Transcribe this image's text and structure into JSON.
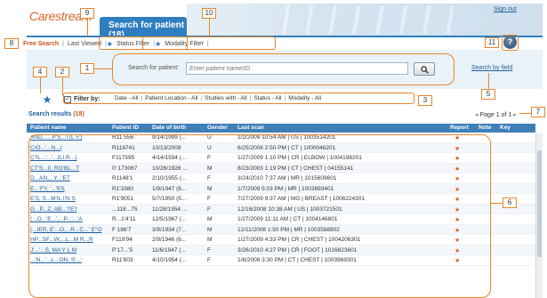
{
  "header": {
    "logo": "Carestream",
    "page_title": "Search for patient (18)",
    "signout": "Sign out"
  },
  "tabs": {
    "free_search": "Free Search",
    "last_viewed": "Last Viewed",
    "status_filter": "Status Filter",
    "modality_filter": "Modality Filter"
  },
  "help": {
    "label": "?"
  },
  "search": {
    "label": "Search for patient:",
    "placeholder": "Enter patient name/ID",
    "by_field": "Search by field"
  },
  "filter": {
    "label": "Filter by:",
    "items": [
      "Date - All",
      "Patient Location - All",
      "Studies with - All",
      "Status - All",
      "Modality - All"
    ]
  },
  "results": {
    "title": "Search results",
    "count": "(18)",
    "page_label": "Page 1 of 1",
    "columns": [
      "Patient name",
      "Patient ID",
      "Date of birth",
      "Gender",
      "Last scan",
      "Report",
      "Note",
      "Key"
    ],
    "rows": [
      [
        "AND...., P'S...T(L 5')",
        "R11 556",
        "9/14/1999 (...",
        "U",
        "1/2/2009 10:54 AM | US | 1003514201"
      ],
      [
        "C/O...'...N...(",
        "R116741",
        "10/13/2009",
        "U",
        "6/25/2008 2:50 PM | CT | 1000046201"
      ],
      [
        "C?L...'...'...(LI.R...)",
        "F117595",
        "4/14/1934 (...",
        "F",
        "1/27/2009 1:10 PM | CR | ELBOW | 1004198201"
      ],
      [
        "CT'S...0, RO'BL...T",
        "0':173067",
        "10/26/1926 ...",
        "M",
        "8/23/2003 1:19 PM | CT | CHEST | 04155141"
      ],
      [
        "D...AN,...Y...'ET",
        "R1148'1",
        "2/10/1955 (...",
        "F",
        "3/24/2010 7:37 AM | MR | 1015609601"
      ],
      [
        "E...'FY, '...'ES",
        "R1'3380",
        "1/9/1947 (6...",
        "M",
        "1/7/2009 5:03 PM | MR | 1003893401"
      ],
      [
        "E'S, S...M'IL I'N S",
        "R1'9051",
        "5/7/1950 (5...",
        "F",
        "7/27/2009 9:37 AM | MG | BREAST | 1006224301"
      ],
      [
        "G...P...Z, AB...'I'E'I",
        "...118...75",
        "11/28/1954 ...",
        "F",
        "12/16/2008 10:38 AM | US | 1003721501"
      ],
      [
        "(...O...'E...',...P...'...'A",
        "R...1'4'11",
        "12/5/1967 (...",
        "M",
        "1/27/2009 11:11 AM | CT | 1004146801"
      ],
      [
        "(...IER, E'...O,...R...C...' E''O",
        "F 186'7",
        "3/9/1934 (7...",
        "M",
        "12/11/2008 1:50 PM | MR | 1003588802"
      ],
      [
        "HP...SF...W,...L...M R...R",
        "F119'94",
        "2/9/1946 (6...",
        "M",
        "1/27/2009 4:33 PM | CR | CHEST | 1004206301"
      ],
      [
        "J'...'...S, MA'Y L M",
        "P'17...'5",
        "11/6/1947 (...",
        "F",
        "3/26/2010 4:27 PM | CR | FOOT | 1016823601"
      ],
      [
        "...'N...'...L...ON, S'...'",
        "R11'803",
        "4/10/1954 (...",
        "F",
        "1/8/2009 3:30 PM | CT | CHEST | 1003969301"
      ]
    ]
  },
  "callouts": [
    "1",
    "2",
    "3",
    "4",
    "5",
    "6",
    "7",
    "8",
    "9",
    "10",
    "11"
  ],
  "colors": {
    "accent": "#e8862a",
    "header_blue": "#3f7fb8",
    "logo": "#d9642a"
  }
}
